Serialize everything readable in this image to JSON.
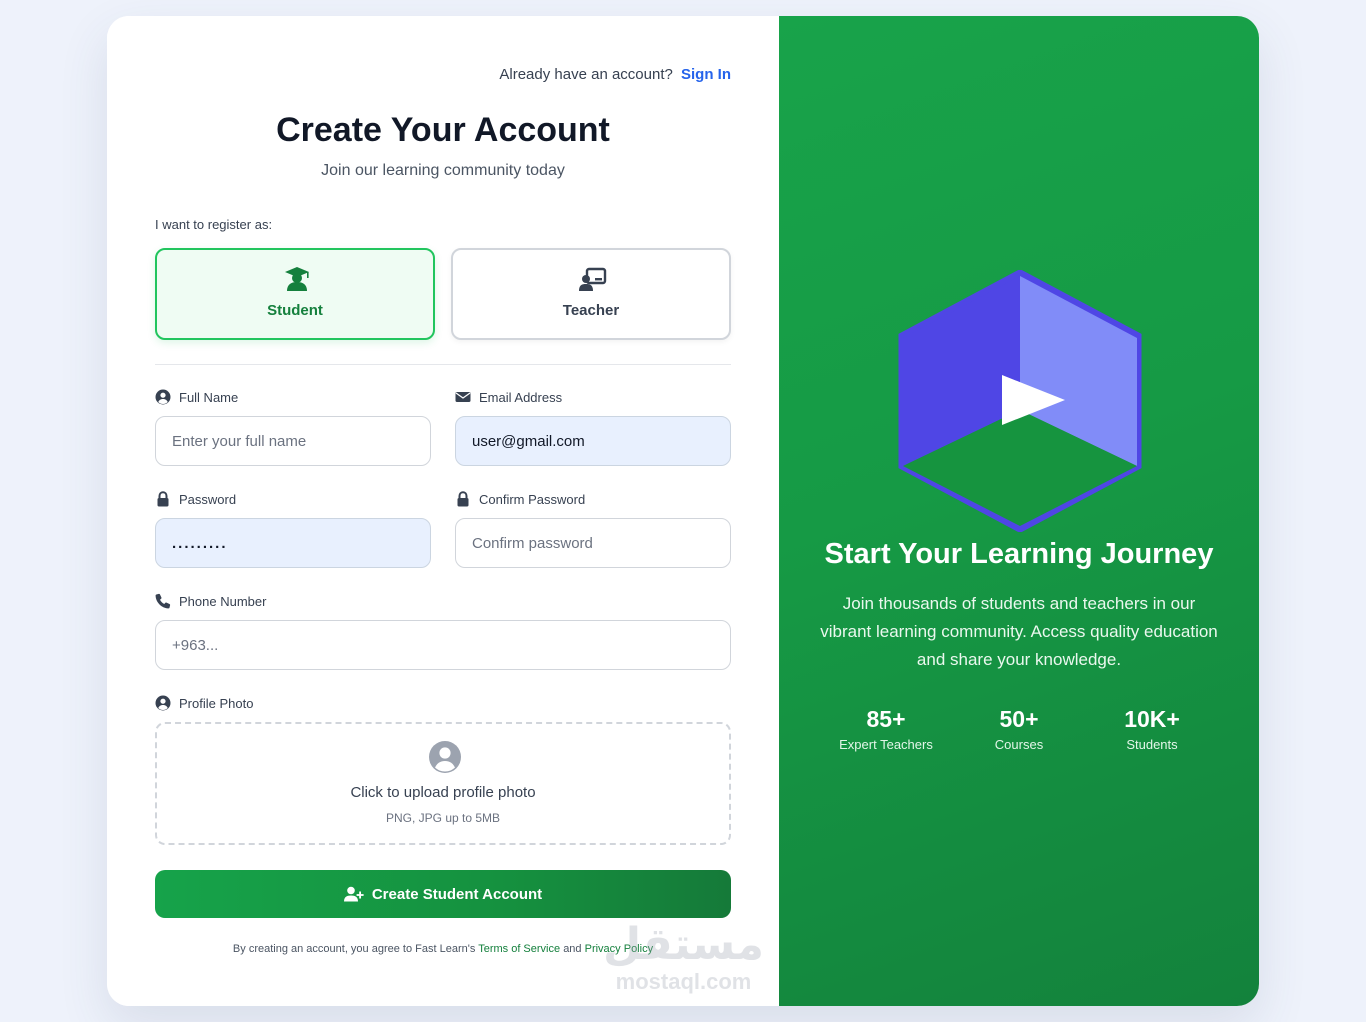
{
  "header": {
    "prompt_text": "Already have an account?",
    "signin_link": "Sign In"
  },
  "form": {
    "title": "Create Your Account",
    "subtitle": "Join our learning community today",
    "register_as_label": "I want to register as:",
    "roles": [
      {
        "label": "Student",
        "icon": "graduate-icon",
        "selected": true
      },
      {
        "label": "Teacher",
        "icon": "teacher-board-icon",
        "selected": false
      }
    ],
    "fields": {
      "full_name": {
        "label": "Full Name",
        "placeholder": "Enter your full name",
        "value": ""
      },
      "email": {
        "label": "Email Address",
        "placeholder": "",
        "value": "user@gmail.com"
      },
      "password": {
        "label": "Password",
        "placeholder": "",
        "value": "........."
      },
      "confirm_password": {
        "label": "Confirm Password",
        "placeholder": "Confirm password",
        "value": ""
      },
      "phone": {
        "label": "Phone Number",
        "placeholder": "+963...",
        "value": ""
      },
      "photo": {
        "label": "Profile Photo",
        "upload_text": "Click to upload profile photo",
        "upload_hint": "PNG, JPG up to 5MB"
      }
    },
    "submit_label": "Create Student Account",
    "terms": {
      "prefix": "By creating an account, you agree to Fast Learn's",
      "tos_link": "Terms of Service",
      "and": "and",
      "privacy_link": "Privacy Policy"
    }
  },
  "hero": {
    "title": "Start Your Learning Journey",
    "description": "Join thousands of students and teachers in our vibrant learning community. Access quality education and share your knowledge.",
    "stats": [
      {
        "value": "85+",
        "label": "Expert Teachers"
      },
      {
        "value": "50+",
        "label": "Courses"
      },
      {
        "value": "10K+",
        "label": "Students"
      }
    ]
  },
  "watermark": {
    "arabic": "مستقل",
    "latin": "mostaql.com"
  },
  "colors": {
    "accent_green": "#16a34a",
    "link_blue": "#2563eb",
    "hero_indigo": "#4f46e5",
    "hero_indigo_light": "#818cf8"
  }
}
